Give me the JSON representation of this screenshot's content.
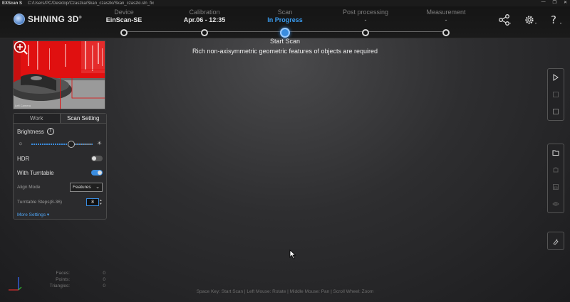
{
  "titlebar": {
    "app": "EXScan S",
    "path": "C:/Users/PC/Desktop/Czaszka/Skan_czaszki/Skan_czaszki.sln_fix",
    "minimize": "—",
    "maximize": "❐",
    "close": "✕"
  },
  "logo": {
    "text": "SHINING 3D",
    "reg": "®"
  },
  "steps": [
    {
      "label": "Device",
      "value": "EinScan-SE"
    },
    {
      "label": "Calibration",
      "value": "Apr.06 - 12:35"
    },
    {
      "label": "Scan",
      "value": "In Progress"
    },
    {
      "label": "Post processing",
      "value": "-"
    },
    {
      "label": "Measurement",
      "value": "-"
    }
  ],
  "header_icons": [
    "share-icon",
    "gear-icon",
    "help-icon"
  ],
  "messages": {
    "primary": "Start Scan",
    "secondary": "Rich non-axisymmetric geometric features of objects are required"
  },
  "preview": {
    "camera_label": "Left Camera"
  },
  "panel": {
    "tabs": [
      "Work",
      "Scan Setting"
    ],
    "brightness_label": "Brightness",
    "brightness_level": 0.62,
    "hdr_label": "HDR",
    "hdr_on": false,
    "turntable_label": "With Turntable",
    "turntable_on": true,
    "align_label": "Align Mode",
    "align_value": "Features",
    "steps_label": "Turntable Steps(8-36)",
    "steps_value": "8",
    "more_label": "More Settings ▾"
  },
  "stats": [
    {
      "key": "Faces:",
      "value": "0"
    },
    {
      "key": "Points:",
      "value": "0"
    },
    {
      "key": "Triangles:",
      "value": "0"
    }
  ],
  "hint": "Space Key: Start Scan | Left Mouse: Rotate | Middle Mouse: Pan | Scroll Wheel: Zoom",
  "colors": {
    "accent": "#3a8de0",
    "active_text": "#3a9cf0",
    "noise": "#e01010"
  }
}
